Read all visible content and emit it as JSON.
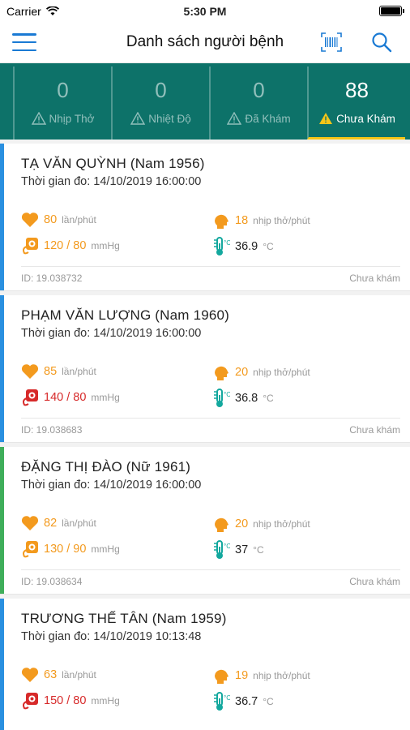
{
  "status_bar": {
    "carrier": "Carrier",
    "time": "5:30 PM"
  },
  "header": {
    "title": "Danh sách người bệnh"
  },
  "tabs": [
    {
      "count": "0",
      "label": "Nhịp Thở",
      "active": false
    },
    {
      "count": "0",
      "label": "Nhiệt Độ",
      "active": false
    },
    {
      "count": "0",
      "label": "Đã Khám",
      "active": false
    },
    {
      "count": "88",
      "label": "Chưa Khám",
      "active": true
    }
  ],
  "colors": {
    "teal": "#0d7269",
    "blue_accent": "#1a7ad4",
    "orange": "#f39a1e",
    "red": "#d72a2a",
    "green_bar": "#3fae5a",
    "blue_bar": "#2a90e0",
    "yellow": "#f5c518"
  },
  "patients": [
    {
      "name": "TẠ VĂN QUỲNH (Nam 1956)",
      "time": "Thời gian đo: 14/10/2019 16:00:00",
      "heart_rate": "80",
      "heart_unit": "lần/phút",
      "blood_pressure": "120 / 80",
      "bp_unit": "mmHg",
      "breath": "18",
      "breath_unit": "nhịp thở/phút",
      "temp": "36.9",
      "temp_unit": "°C",
      "id": "ID: 19.038732",
      "status": "Chưa khám"
    },
    {
      "name": "PHẠM VĂN LƯỢNG (Nam 1960)",
      "time": "Thời gian đo: 14/10/2019 16:00:00",
      "heart_rate": "85",
      "heart_unit": "lần/phút",
      "blood_pressure": "140 / 80",
      "bp_unit": "mmHg",
      "breath": "20",
      "breath_unit": "nhịp thở/phút",
      "temp": "36.8",
      "temp_unit": "°C",
      "id": "ID: 19.038683",
      "status": "Chưa khám"
    },
    {
      "name": "ĐẶNG THỊ ĐÀO (Nữ 1961)",
      "time": "Thời gian đo: 14/10/2019 16:00:00",
      "heart_rate": "82",
      "heart_unit": "lần/phút",
      "blood_pressure": "130 / 90",
      "bp_unit": "mmHg",
      "breath": "20",
      "breath_unit": "nhịp thở/phút",
      "temp": "37",
      "temp_unit": "°C",
      "id": "ID: 19.038634",
      "status": "Chưa khám"
    },
    {
      "name": "TRƯƠNG THẾ TÂN (Nam 1959)",
      "time": "Thời gian đo: 14/10/2019 10:13:48",
      "heart_rate": "63",
      "heart_unit": "lần/phút",
      "blood_pressure": "150 / 80",
      "bp_unit": "mmHg",
      "breath": "19",
      "breath_unit": "nhịp thở/phút",
      "temp": "36.7",
      "temp_unit": "°C",
      "id": "",
      "status": ""
    }
  ]
}
